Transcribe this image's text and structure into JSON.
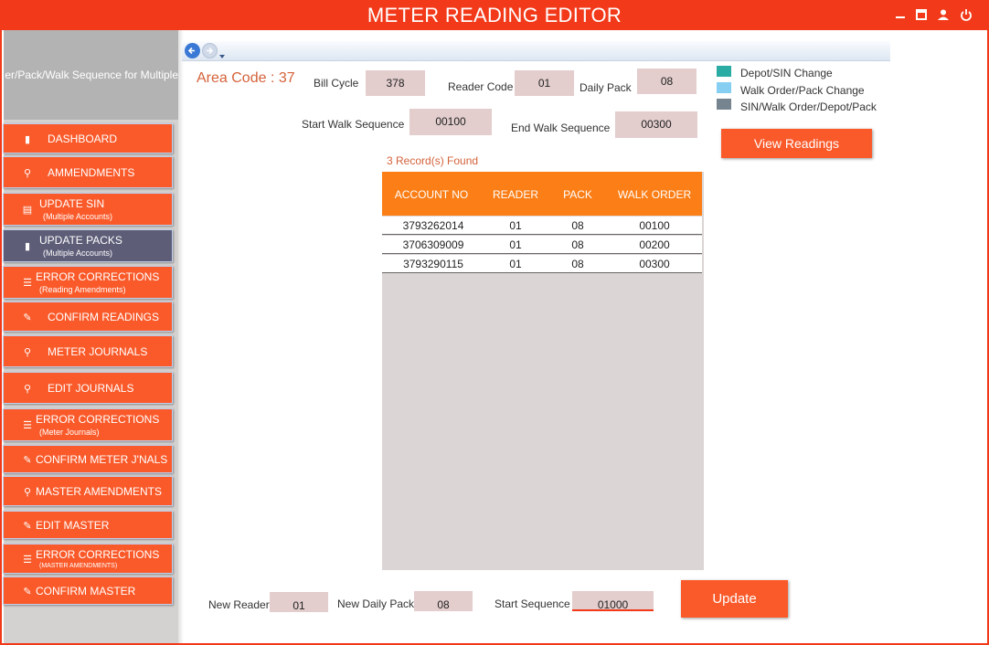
{
  "window": {
    "title": "METER READING EDITOR",
    "controls": [
      "minimize-icon",
      "maximize-icon",
      "user-icon",
      "power-icon"
    ]
  },
  "sidebar": {
    "header": "er/Pack/Walk Sequence for Multiple",
    "items": [
      {
        "label": "DASHBOARD",
        "sub": "",
        "icon": "bookmark-icon",
        "active": false
      },
      {
        "label": "AMMENDMENTS",
        "sub": "",
        "icon": "user-edit-icon",
        "active": false
      },
      {
        "label": "UPDATE SIN",
        "sub": "(Multiple Accounts)",
        "icon": "document-icon",
        "active": false
      },
      {
        "label": "UPDATE PACKS",
        "sub": "(Multiple Accounts)",
        "icon": "bookmark-icon",
        "active": true
      },
      {
        "label": "ERROR CORRECTIONS",
        "sub": "(Reading Amendments)",
        "icon": "list-icon",
        "active": false
      },
      {
        "label": "CONFIRM READINGS",
        "sub": "",
        "icon": "pencil-icon",
        "active": false
      },
      {
        "label": "METER JOURNALS",
        "sub": "",
        "icon": "user-edit-icon",
        "active": false
      },
      {
        "label": "EDIT JOURNALS",
        "sub": "",
        "icon": "user-edit-icon",
        "active": false
      },
      {
        "label": "ERROR CORRECTIONS",
        "sub": "(Meter Journals)",
        "icon": "list-icon",
        "active": false
      },
      {
        "label": "CONFIRM METER J'NALS",
        "sub": "",
        "icon": "pencil-icon",
        "active": false
      },
      {
        "label": "MASTER AMENDMENTS",
        "sub": "",
        "icon": "user-edit-icon",
        "active": false
      },
      {
        "label": "EDIT MASTER",
        "sub": "",
        "icon": "pencil-icon",
        "active": false
      },
      {
        "label": "ERROR CORRECTIONS",
        "sub": "(MASTER AMENDMENTS)",
        "icon": "list-icon",
        "active": false
      },
      {
        "label": "CONFIRM MASTER",
        "sub": "",
        "icon": "pencil-icon",
        "active": false
      }
    ]
  },
  "form": {
    "area_code": "Area Code : 37",
    "bill_cycle_label": "Bill Cycle",
    "bill_cycle": "378",
    "reader_code_label": "Reader Code",
    "reader_code": "01",
    "daily_pack_label": "Daily Pack",
    "daily_pack": "08",
    "start_walk_label": "Start Walk Sequence",
    "start_walk": "00100",
    "end_walk_label": "End Walk Sequence",
    "end_walk": "00300"
  },
  "legend": [
    {
      "label": "Depot/SIN Change",
      "color": "#2aaca4"
    },
    {
      "label": "Walk Order/Pack Change",
      "color": "#86cff3"
    },
    {
      "label": "SIN/Walk Order/Depot/Pack",
      "color": "#75848e"
    }
  ],
  "view_button": "View Readings",
  "records_found": "3 Record(s) Found",
  "table": {
    "columns": [
      "ACCOUNT NO",
      "READER",
      "PACK",
      "WALK ORDER"
    ],
    "rows": [
      [
        "3793262014",
        "01",
        "08",
        "00100"
      ],
      [
        "3706309009",
        "01",
        "08",
        "00200"
      ],
      [
        "3793290115",
        "01",
        "08",
        "00300"
      ]
    ]
  },
  "bottom": {
    "new_reader_label": "New Reader",
    "new_reader": "01",
    "new_daily_pack_label": "New Daily Pack",
    "new_daily_pack": "08",
    "start_sequence_label": "Start Sequence",
    "start_sequence": "01000"
  },
  "update_button": "Update",
  "colors": {
    "accent": "#f23a1a",
    "button": "#fa5a2a",
    "active_nav": "#5d5d78",
    "table_header": "#fb7e16",
    "field_bg": "#e3cdcd"
  }
}
